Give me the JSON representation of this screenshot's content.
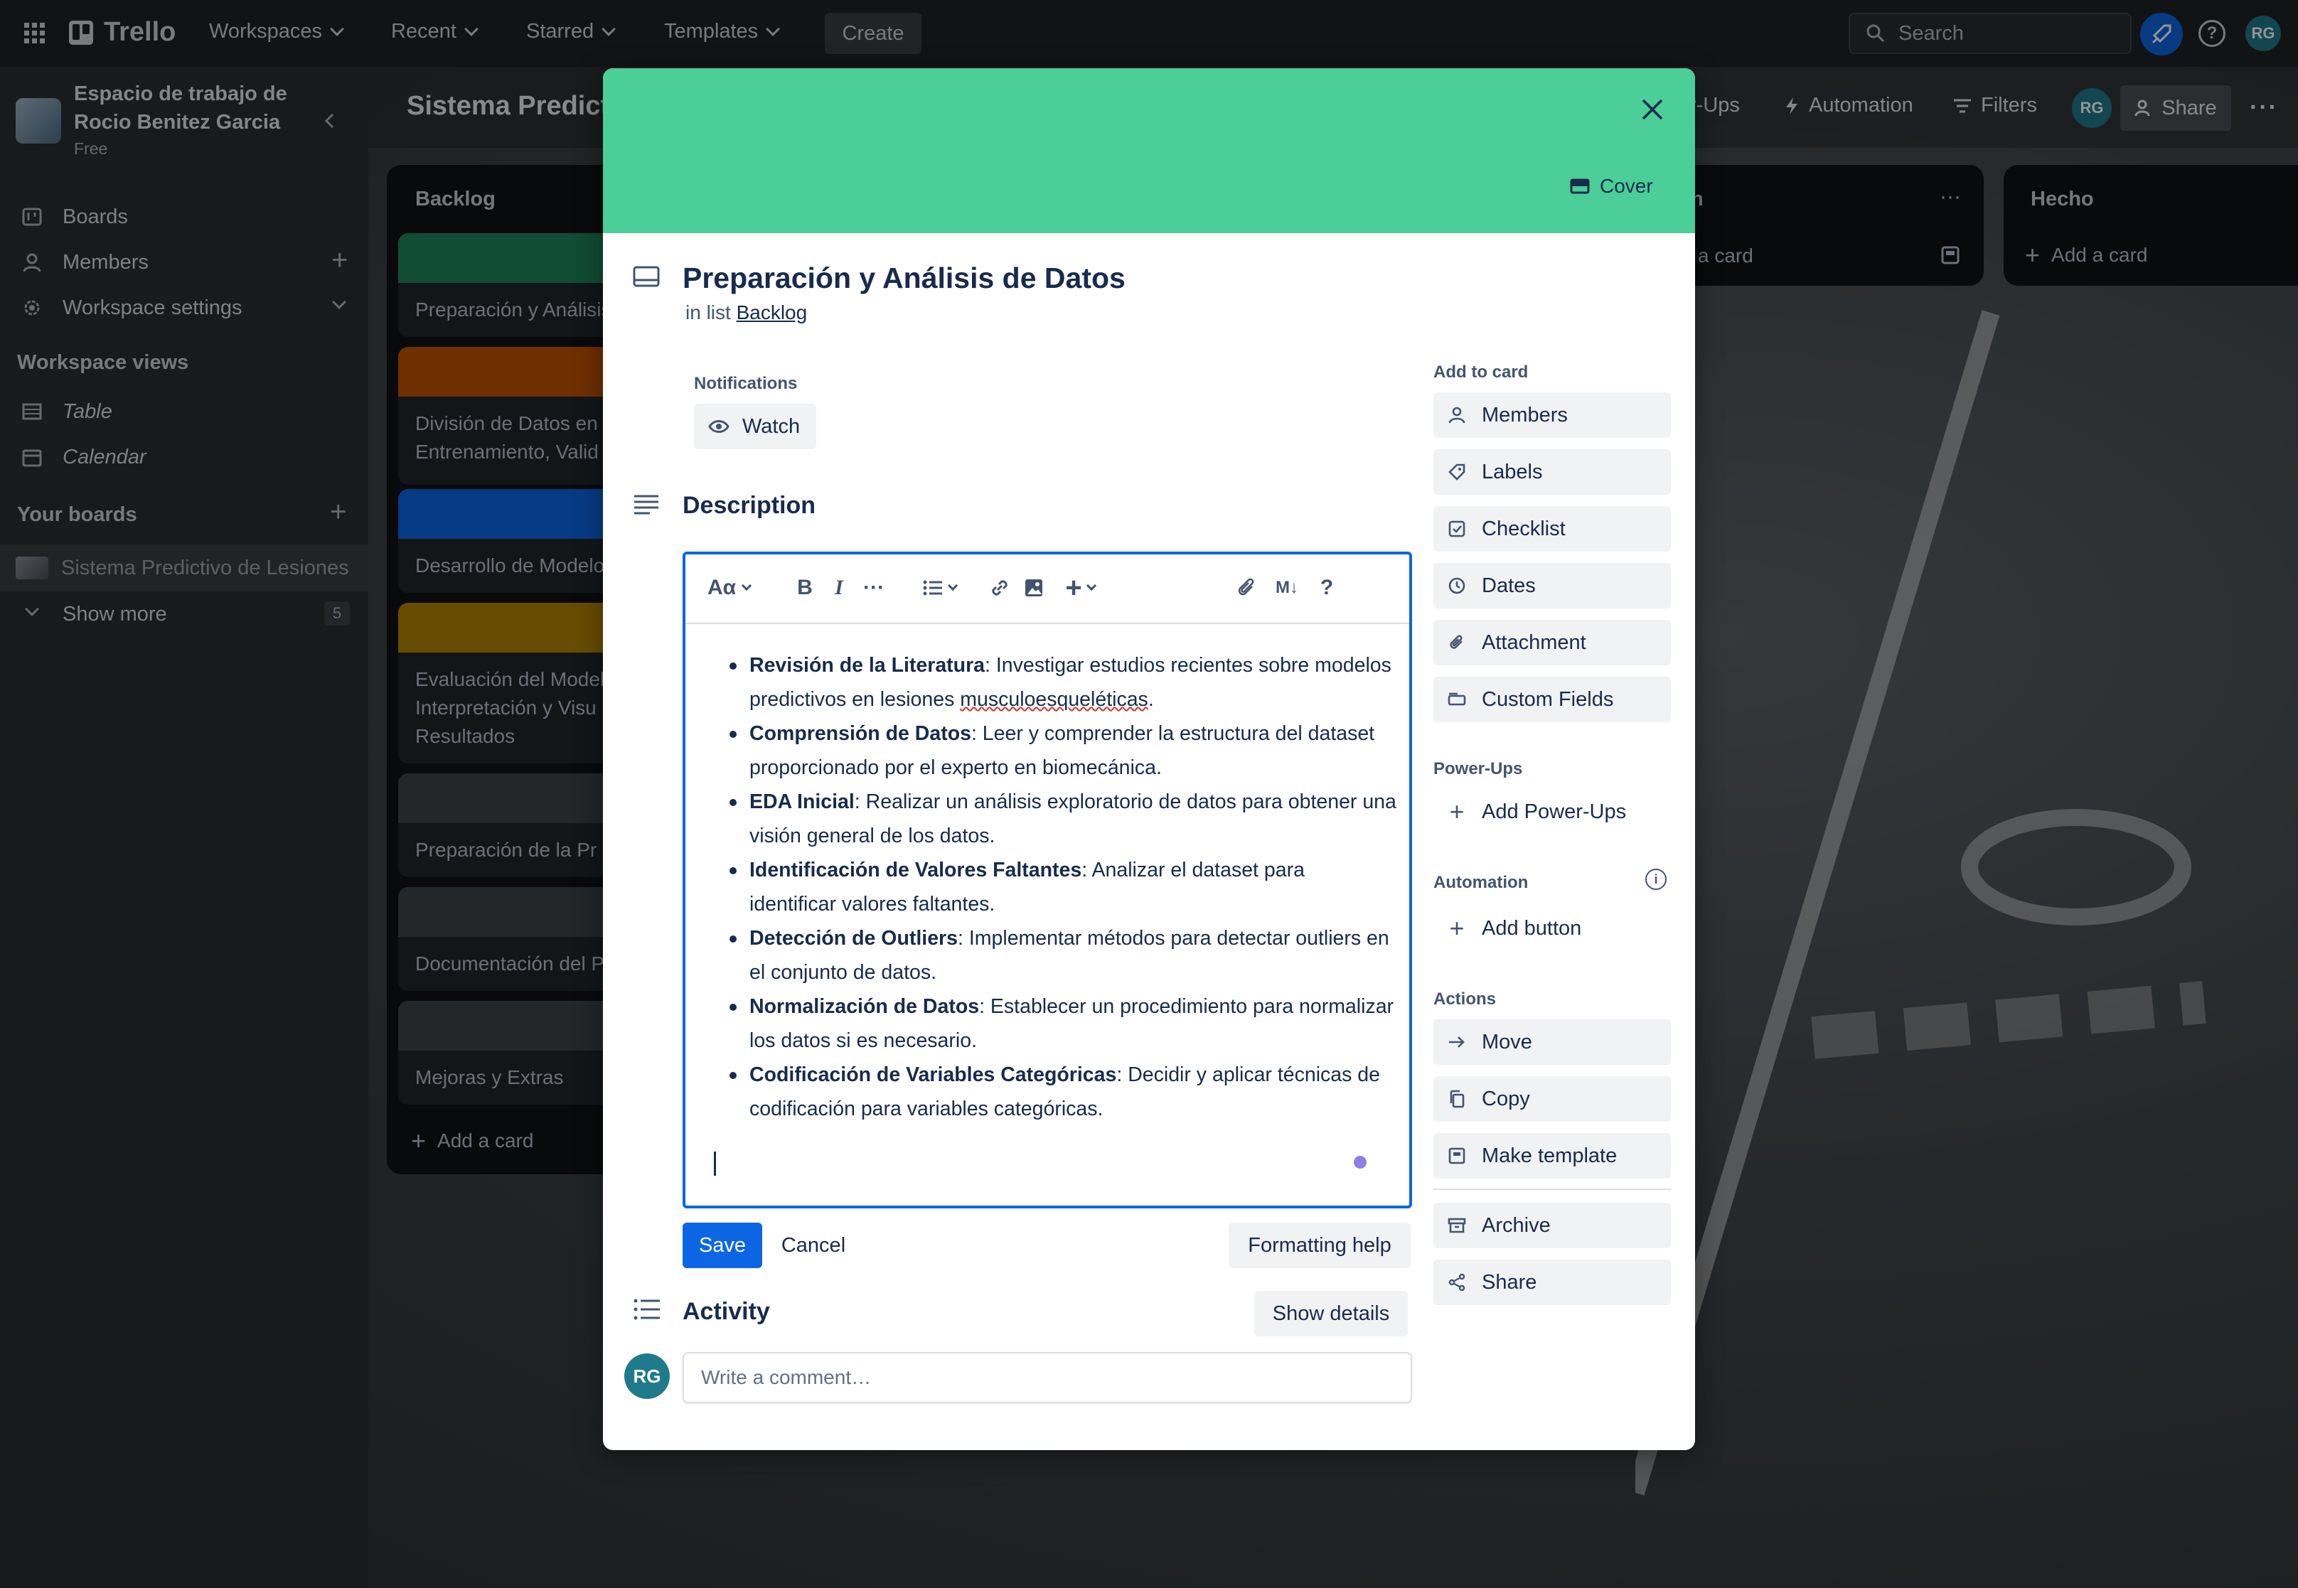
{
  "topbar": {
    "logo": "Trello",
    "menus": [
      "Workspaces",
      "Recent",
      "Starred",
      "Templates"
    ],
    "create": "Create",
    "search_placeholder": "Search",
    "user_initials": "RG"
  },
  "sidebar": {
    "workspace_name": "Espacio de trabajo de Rocio Benitez Garcia",
    "workspace_plan": "Free",
    "items": [
      {
        "label": "Boards",
        "icon": "board-icon"
      },
      {
        "label": "Members",
        "icon": "person-icon"
      },
      {
        "label": "Workspace settings",
        "icon": "gear-icon"
      }
    ],
    "views_heading": "Workspace views",
    "views": [
      {
        "label": "Table",
        "icon": "table-icon"
      },
      {
        "label": "Calendar",
        "icon": "calendar-icon"
      }
    ],
    "boards_heading": "Your boards",
    "boards": [
      {
        "label": "Sistema Predictivo de Lesiones"
      }
    ],
    "show_more": "Show more",
    "show_more_count": "5"
  },
  "board": {
    "title": "Sistema Predicti",
    "header_buttons": [
      "r-Ups",
      "Automation",
      "Filters"
    ],
    "share": "Share",
    "lists": [
      {
        "title": "Backlog",
        "cards": [
          {
            "text": "Preparación y Análisis",
            "cover": "#1f845a"
          },
          {
            "text": "División de Datos en Entrenamiento, Valid",
            "cover": "#c25100"
          },
          {
            "text": "Desarrollo de Modelo",
            "cover": "#0c66e4"
          },
          {
            "text": "Evaluación del Model Interpretación y Visu Resultados",
            "cover": "#b38600"
          },
          {
            "text": "Preparación de la Pr",
            "cover": "#3d4449"
          },
          {
            "text": "Documentación del P",
            "cover": "#3d4449"
          },
          {
            "text": "Mejoras y Extras",
            "cover": "#3d4449"
          }
        ],
        "add_card": "Add a card"
      },
      {
        "title": "n",
        "add_card": "a card"
      },
      {
        "title": "Hecho",
        "add_card": "Add a card"
      }
    ]
  },
  "modal": {
    "cover_button": "Cover",
    "cover_color": "#4bce97",
    "title": "Preparación y Análisis de Datos",
    "in_list_prefix": "in list",
    "list_name": "Backlog",
    "notifications_label": "Notifications",
    "watch": "Watch",
    "description_title": "Description",
    "toolbar": {
      "text_style": "Aα",
      "bold": "B",
      "italic": "I",
      "more": "···",
      "help": "?"
    },
    "description_items": [
      {
        "bold": "Revisión de la Literatura",
        "rest": ": Investigar estudios recientes sobre modelos predictivos en lesiones ",
        "flagged": "musculoesqueléticas",
        "tail": "."
      },
      {
        "bold": "Comprensión de Datos",
        "rest": ": Leer y comprender la estructura del dataset proporcionado por el experto en biomecánica.",
        "flagged": "",
        "tail": ""
      },
      {
        "bold": "EDA Inicial",
        "rest": ": Realizar un análisis exploratorio de datos para obtener una visión general de los datos.",
        "flagged": "",
        "tail": ""
      },
      {
        "bold": "Identificación de Valores Faltantes",
        "rest": ": Analizar el dataset para identificar valores faltantes.",
        "flagged": "",
        "tail": ""
      },
      {
        "bold": "Detección de Outliers",
        "rest": ": Implementar métodos para detectar outliers en el conjunto de datos.",
        "flagged": "",
        "tail": ""
      },
      {
        "bold": "Normalización de Datos",
        "rest": ": Establecer un procedimiento para normalizar los datos si es necesario.",
        "flagged": "",
        "tail": ""
      },
      {
        "bold": "Codificación de Variables Categóricas",
        "rest": ": Decidir y aplicar técnicas de codificación para variables categóricas.",
        "flagged": "",
        "tail": ""
      }
    ],
    "save": "Save",
    "cancel": "Cancel",
    "formatting_help": "Formatting help",
    "activity_title": "Activity",
    "show_details": "Show details",
    "comment_placeholder": "Write a comment…",
    "user_initials": "RG",
    "add_to_card_label": "Add to card",
    "add_to_card": [
      {
        "label": "Members",
        "icon": "person-icon"
      },
      {
        "label": "Labels",
        "icon": "tag-icon"
      },
      {
        "label": "Checklist",
        "icon": "checklist-icon"
      },
      {
        "label": "Dates",
        "icon": "clock-icon"
      },
      {
        "label": "Attachment",
        "icon": "paperclip-icon"
      },
      {
        "label": "Custom Fields",
        "icon": "custom-fields-icon"
      }
    ],
    "powerups_label": "Power-Ups",
    "add_powerups": "Add Power-Ups",
    "automation_label": "Automation",
    "add_button": "Add button",
    "actions_label": "Actions",
    "actions": [
      {
        "label": "Move",
        "icon": "arrow-right-icon"
      },
      {
        "label": "Copy",
        "icon": "copy-icon"
      },
      {
        "label": "Make template",
        "icon": "template-icon"
      },
      {
        "label": "Archive",
        "icon": "archive-icon"
      },
      {
        "label": "Share",
        "icon": "share-icon"
      }
    ],
    "accent_color": "#0c66e4"
  }
}
